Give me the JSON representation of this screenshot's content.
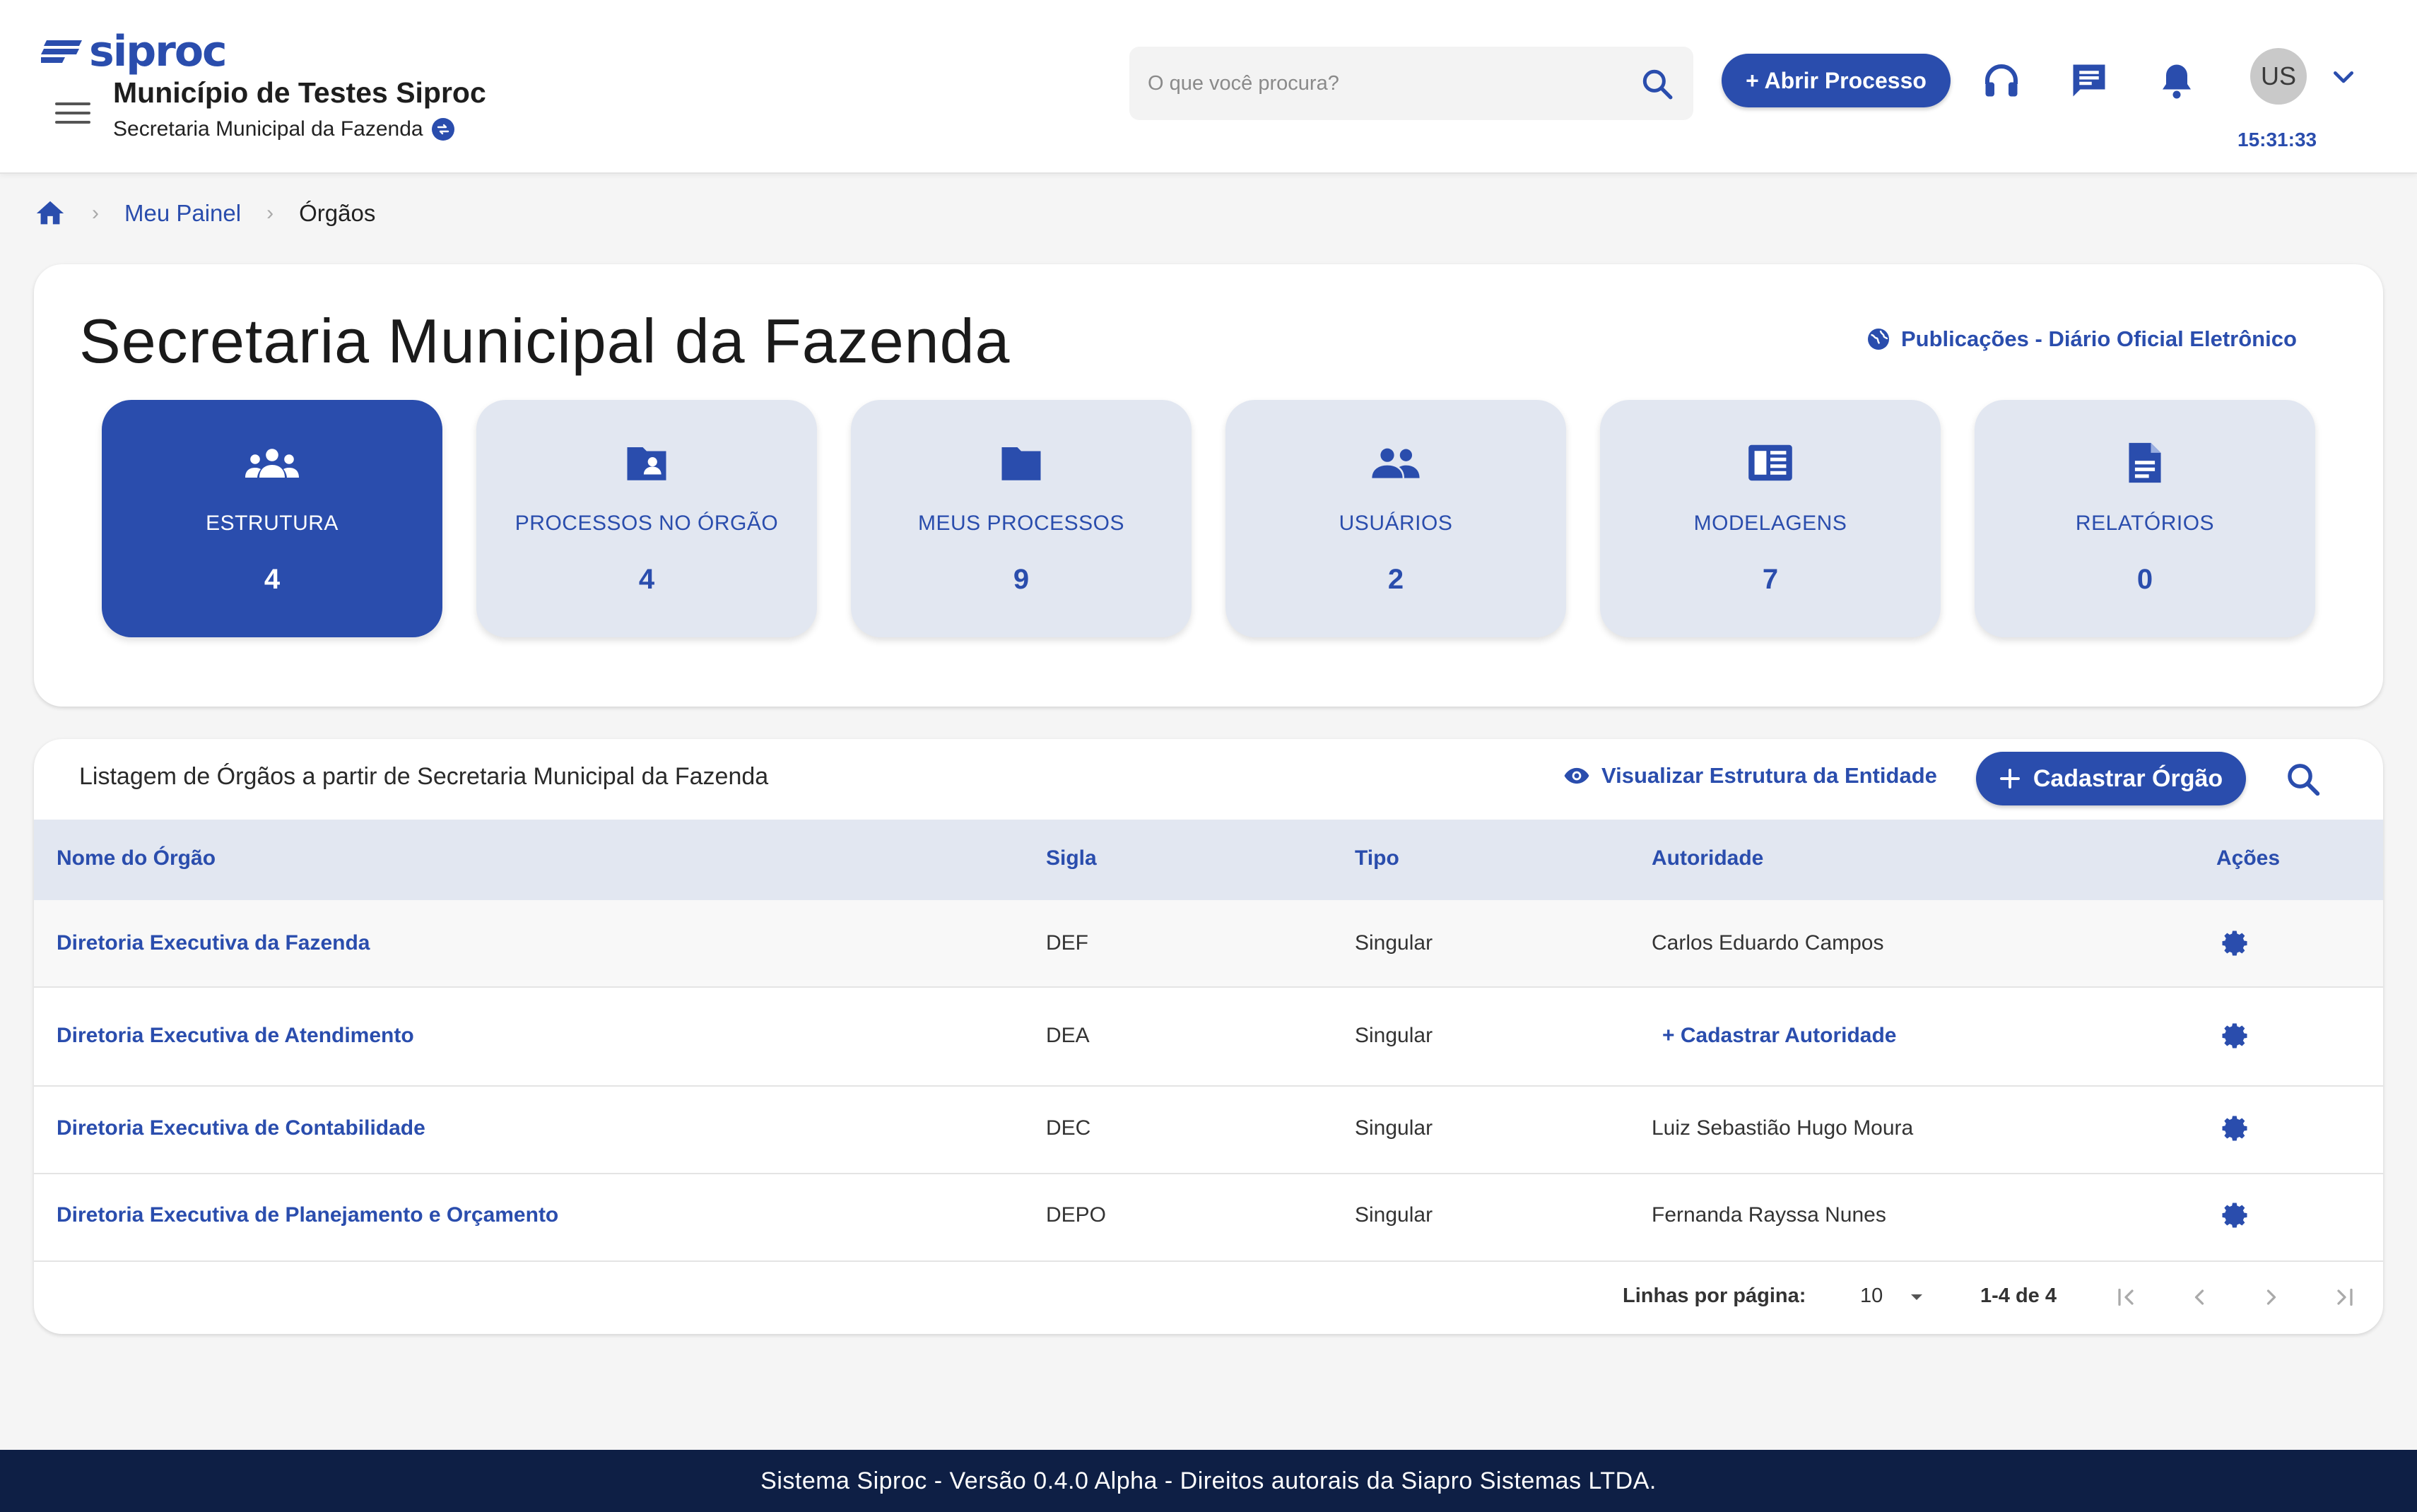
{
  "app": {
    "logo_text": "siproc",
    "brand_color": "#2a4dad"
  },
  "header": {
    "municipality": "Município de Testes Siproc",
    "department": "Secretaria Municipal da Fazenda",
    "search_placeholder": "O que você procura?",
    "open_process_label": "+ Abrir Processo",
    "user_initials": "US",
    "clock": "15:31:33",
    "icons": [
      "menu-icon",
      "swap-icon",
      "search-icon",
      "headset-icon",
      "chat-icon",
      "bell-icon",
      "chevron-down-icon"
    ]
  },
  "breadcrumb": {
    "items": [
      "Meu Painel",
      "Órgãos"
    ]
  },
  "dashboard": {
    "title": "Secretaria Municipal da Fazenda",
    "publications_link": "Publicações - Diário Oficial Eletrônico",
    "tiles": [
      {
        "label": "ESTRUTURA",
        "count": "4",
        "icon": "groups-icon",
        "active": true
      },
      {
        "label": "PROCESSOS NO ÓRGÃO",
        "count": "4",
        "icon": "folder-shared-icon",
        "active": false
      },
      {
        "label": "MEUS PROCESSOS",
        "count": "9",
        "icon": "folder-icon",
        "active": false
      },
      {
        "label": "USUÁRIOS",
        "count": "2",
        "icon": "people-icon",
        "active": false
      },
      {
        "label": "MODELAGENS",
        "count": "7",
        "icon": "newspaper-icon",
        "active": false
      },
      {
        "label": "RELATÓRIOS",
        "count": "0",
        "icon": "document-icon",
        "active": false
      }
    ]
  },
  "listing": {
    "title": "Listagem de Órgãos a partir de Secretaria Municipal da Fazenda",
    "view_structure_label": "Visualizar Estrutura da Entidade",
    "add_button_label": "Cadastrar Órgão",
    "columns": [
      "Nome do Órgão",
      "Sigla",
      "Tipo",
      "Autoridade",
      "Ações"
    ],
    "rows": [
      {
        "name": "Diretoria Executiva da Fazenda",
        "sigla": "DEF",
        "tipo": "Singular",
        "autoridade": "Carlos Eduardo Campos"
      },
      {
        "name": "Diretoria Executiva de Atendimento",
        "sigla": "DEA",
        "tipo": "Singular",
        "autoridade": "+ Cadastrar Autoridade"
      },
      {
        "name": "Diretoria Executiva de Contabilidade",
        "sigla": "DEC",
        "tipo": "Singular",
        "autoridade": "Luiz Sebastião Hugo Moura"
      },
      {
        "name": "Diretoria Executiva de Planejamento e Orçamento",
        "sigla": "DEPO",
        "tipo": "Singular",
        "autoridade": "Fernanda Rayssa Nunes"
      }
    ],
    "pagination": {
      "rows_per_page_label": "Linhas por página:",
      "rows_per_page": "10",
      "range": "1-4 de 4"
    }
  },
  "footer": {
    "text": "Sistema Siproc - Versão 0.4.0 Alpha - Direitos autorais da Siapro Sistemas LTDA."
  }
}
